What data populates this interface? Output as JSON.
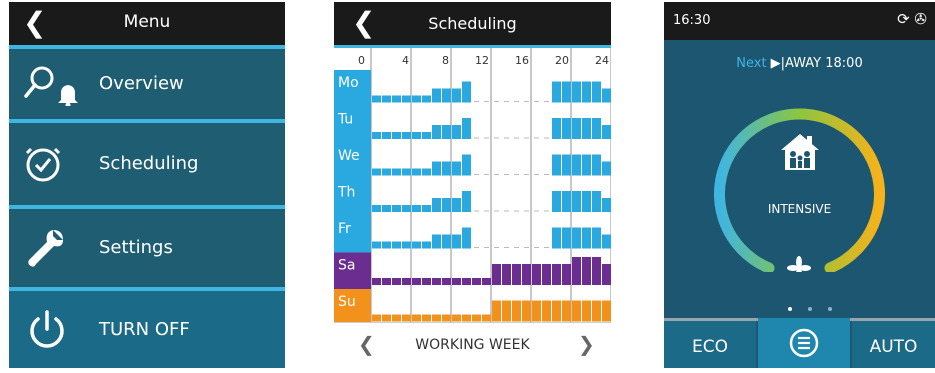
{
  "colors": {
    "accent": "#3fb5e2",
    "menu_bg": "#1f5d72",
    "header_bg": "#1a1a1a",
    "saturday": "#6b2d8f",
    "sunday": "#f2911b"
  },
  "menu": {
    "title": "Menu",
    "back_icon": "chevron-left-icon",
    "items": [
      {
        "label": "Overview",
        "icon": "overview-icon"
      },
      {
        "label": "Scheduling",
        "icon": "clock-icon"
      },
      {
        "label": "Settings",
        "icon": "wrench-icon"
      },
      {
        "label": "TURN OFF",
        "icon": "power-icon"
      }
    ]
  },
  "scheduling": {
    "title": "Scheduling",
    "hour_labels": [
      "0",
      "4",
      "8",
      "12",
      "16",
      "20",
      "24"
    ],
    "days": [
      {
        "label": "Mo",
        "color": "#29a9e0",
        "levels": [
          1,
          1,
          1,
          1,
          1,
          1,
          2,
          2,
          2,
          3,
          0,
          0,
          0,
          0,
          0,
          0,
          0,
          0,
          3,
          3,
          3,
          3,
          3,
          2,
          1
        ]
      },
      {
        "label": "Tu",
        "color": "#29a9e0",
        "levels": [
          1,
          1,
          1,
          1,
          1,
          1,
          2,
          2,
          2,
          3,
          0,
          0,
          0,
          0,
          0,
          0,
          0,
          0,
          3,
          3,
          3,
          3,
          3,
          2,
          1
        ]
      },
      {
        "label": "We",
        "color": "#29a9e0",
        "levels": [
          1,
          1,
          1,
          1,
          1,
          1,
          2,
          2,
          2,
          3,
          0,
          0,
          0,
          0,
          0,
          0,
          0,
          0,
          3,
          3,
          3,
          3,
          3,
          2,
          1
        ]
      },
      {
        "label": "Th",
        "color": "#29a9e0",
        "levels": [
          1,
          1,
          1,
          1,
          1,
          1,
          2,
          2,
          2,
          3,
          0,
          0,
          0,
          0,
          0,
          0,
          0,
          0,
          3,
          3,
          3,
          3,
          3,
          2,
          1
        ]
      },
      {
        "label": "Fr",
        "color": "#29a9e0",
        "levels": [
          1,
          1,
          1,
          1,
          1,
          1,
          2,
          2,
          2,
          3,
          0,
          0,
          0,
          0,
          0,
          0,
          0,
          0,
          3,
          3,
          3,
          3,
          3,
          2,
          1
        ]
      },
      {
        "label": "Sa",
        "color": "#6b2d8f",
        "levels": [
          1,
          1,
          1,
          1,
          1,
          1,
          1,
          1,
          1,
          1,
          1,
          1,
          3,
          3,
          3,
          3,
          3,
          3,
          3,
          3,
          4,
          4,
          4,
          3,
          1
        ]
      },
      {
        "label": "Su",
        "color": "#f2911b",
        "levels": [
          1,
          1,
          1,
          1,
          1,
          1,
          1,
          1,
          1,
          1,
          1,
          1,
          3,
          3,
          3,
          3,
          3,
          3,
          3,
          3,
          3,
          3,
          3,
          3,
          1
        ]
      }
    ],
    "footer_label": "WORKING WEEK",
    "prev_icon": "chevron-left-icon",
    "next_icon": "chevron-right-icon"
  },
  "home": {
    "time": "16:30",
    "status_icons": [
      "sync-icon",
      "fan-icon"
    ],
    "next_label": "Next",
    "next_event": "AWAY 18:00",
    "mode_label": "INTENSIVE",
    "mode_icon": "house-family-icon",
    "level_icon": "fan-icon",
    "page_dots": 3,
    "active_dot": 0,
    "buttons": [
      {
        "label": "ECO"
      },
      {
        "label": "",
        "icon": "menu-icon"
      },
      {
        "label": "AUTO"
      }
    ]
  }
}
